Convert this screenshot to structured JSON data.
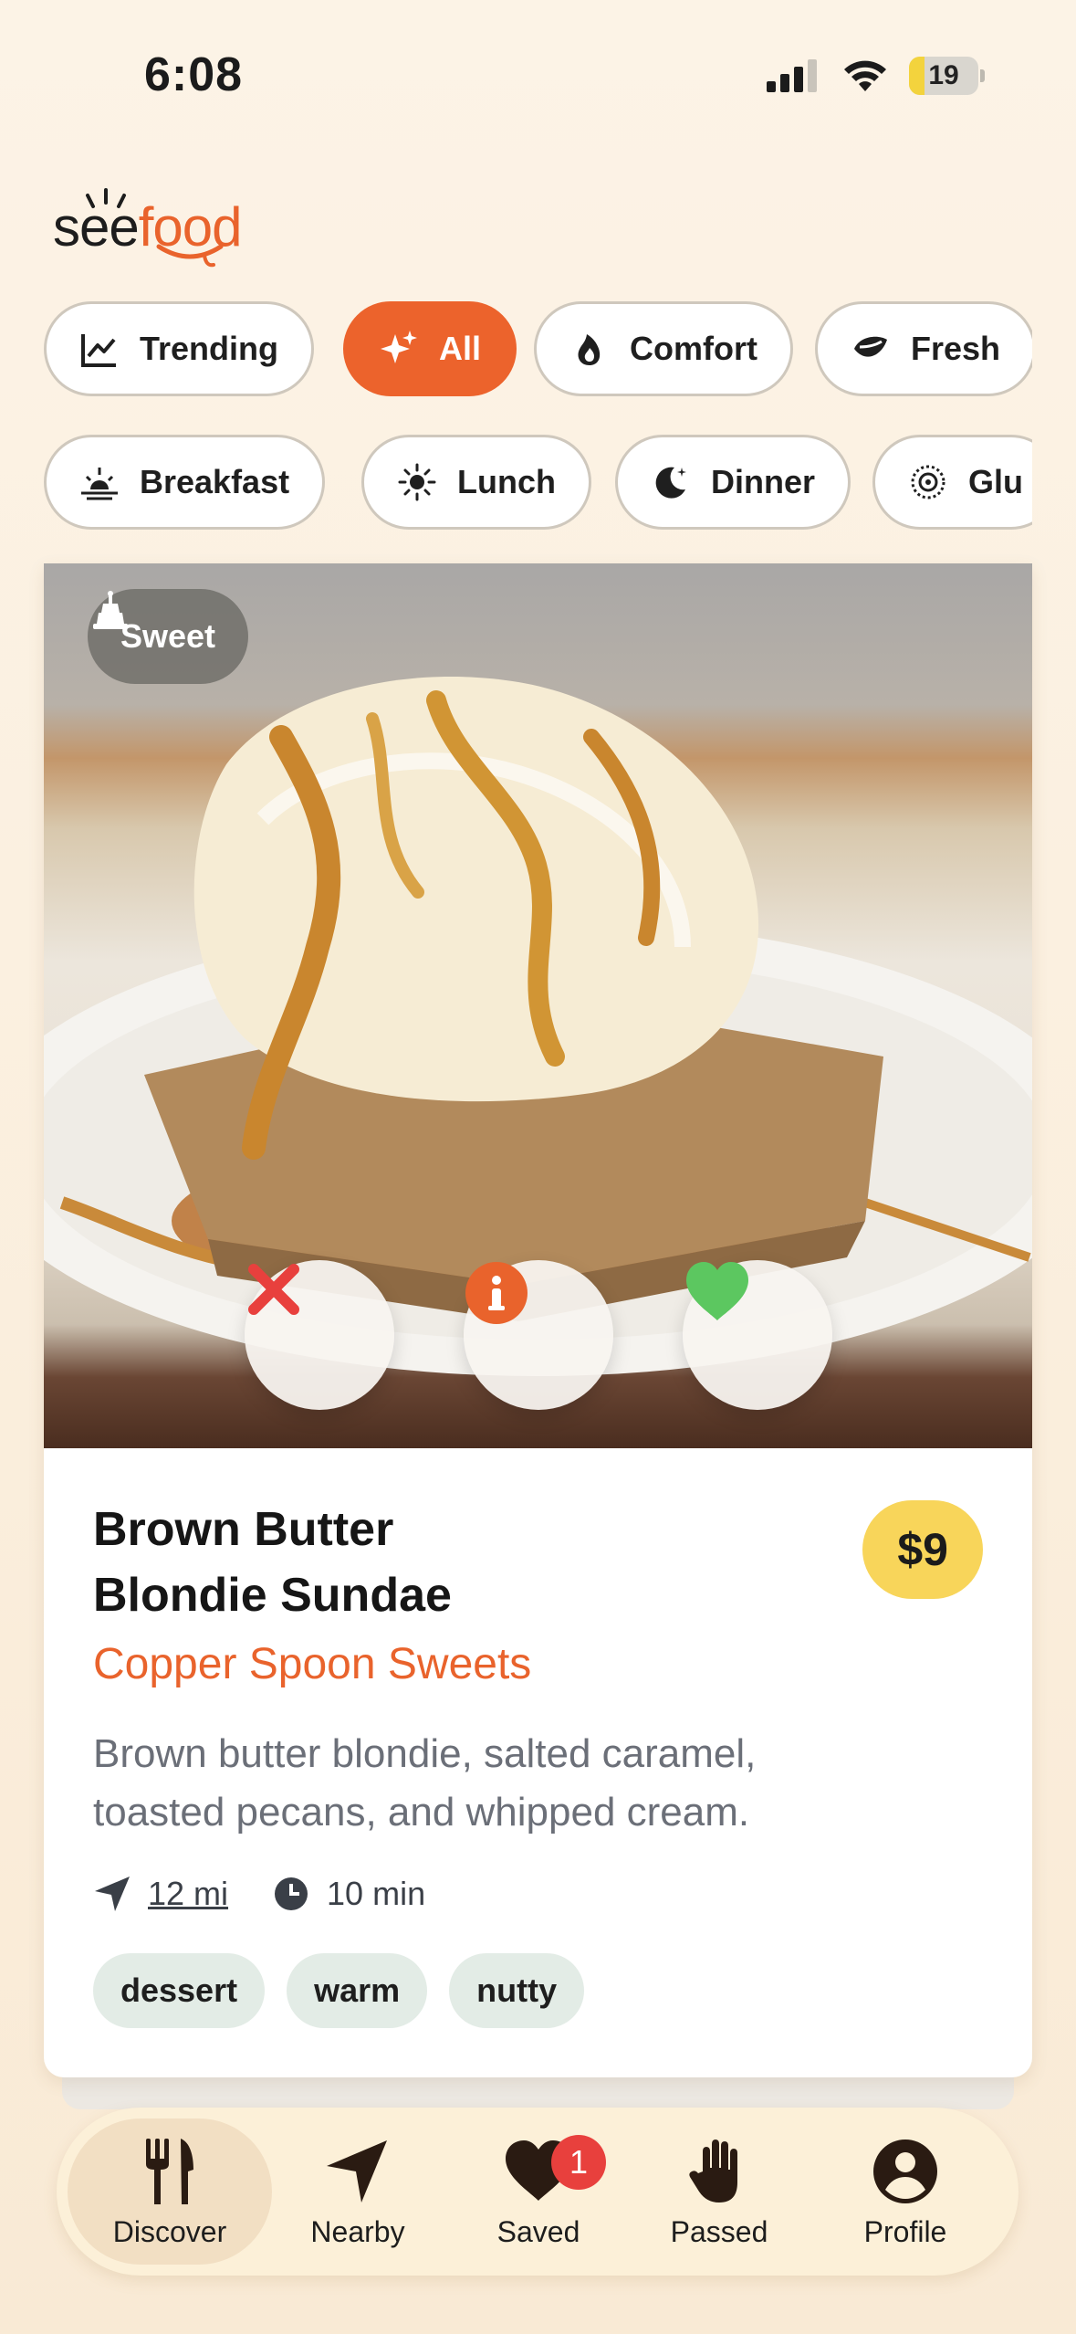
{
  "status_bar": {
    "time": "6:08",
    "battery": "19"
  },
  "logo": {
    "part1": "see",
    "part2": "food"
  },
  "categories_row1": [
    {
      "label": "Trending",
      "icon": "trending-icon",
      "active": false
    },
    {
      "label": "All",
      "icon": "sparkles-icon",
      "active": true
    },
    {
      "label": "Comfort",
      "icon": "flame-icon",
      "active": false
    },
    {
      "label": "Fresh",
      "icon": "leaf-icon",
      "active": false
    }
  ],
  "categories_row2": [
    {
      "label": "Breakfast",
      "icon": "sunrise-icon"
    },
    {
      "label": "Lunch",
      "icon": "sun-icon"
    },
    {
      "label": "Dinner",
      "icon": "moon-icon"
    },
    {
      "label": "Glu",
      "icon": "gluten-icon"
    }
  ],
  "card": {
    "badge": "Sweet",
    "title_line1": "Brown Butter",
    "title_line2": "Blondie Sundae",
    "restaurant": "Copper Spoon Sweets",
    "price": "$9",
    "description_line1": "Brown butter blondie, salted caramel,",
    "description_line2": "toasted pecans, and whipped cream.",
    "distance": "12 mi",
    "time": "10 min",
    "tags": [
      "dessert",
      "warm",
      "nutty"
    ]
  },
  "nav": {
    "items": [
      {
        "label": "Discover",
        "icon": "fork-knife-icon",
        "active": true
      },
      {
        "label": "Nearby",
        "icon": "location-arrow-icon",
        "active": false
      },
      {
        "label": "Saved",
        "icon": "heart-icon",
        "active": false
      },
      {
        "label": "Passed",
        "icon": "hand-icon",
        "active": false
      },
      {
        "label": "Profile",
        "icon": "person-icon",
        "active": false
      }
    ],
    "saved_badge": "1"
  },
  "colors": {
    "accent": "#ec632c",
    "price_bg": "#f8d55a",
    "like": "#5cc760",
    "pass": "#e8403d"
  }
}
